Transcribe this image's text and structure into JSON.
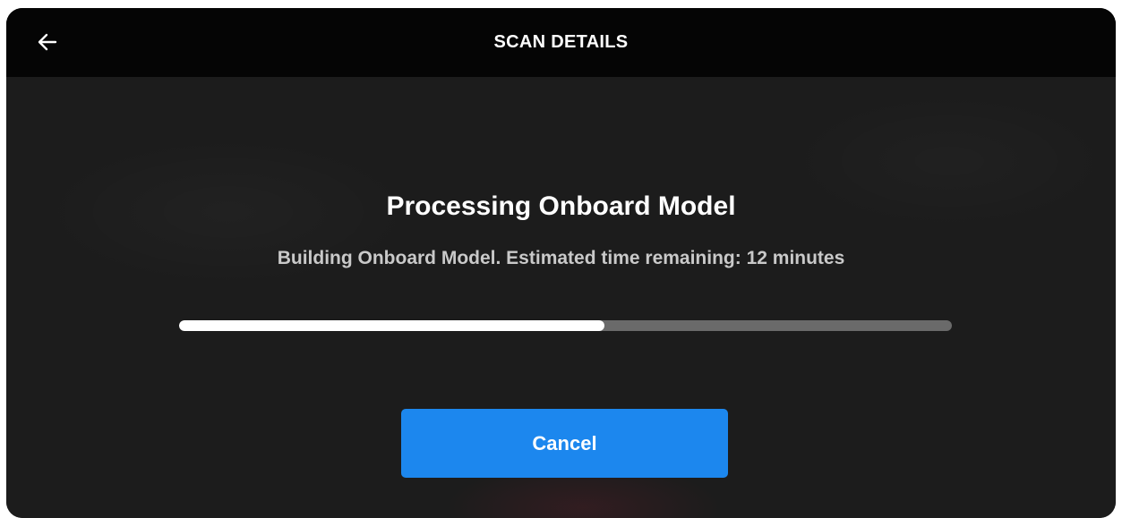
{
  "header": {
    "title": "SCAN DETAILS",
    "back_icon": "arrow-left-icon"
  },
  "main": {
    "heading": "Processing Onboard Model",
    "status_text": "Building Onboard Model. Estimated time remaining:  12 minutes",
    "progress_fraction": 0.55,
    "cancel_label": "Cancel"
  },
  "colors": {
    "accent": "#1c87ee",
    "topbar": "#050505",
    "background": "#1c1c1c",
    "progress_track": "#6a6a6a",
    "progress_fill": "#ffffff"
  }
}
